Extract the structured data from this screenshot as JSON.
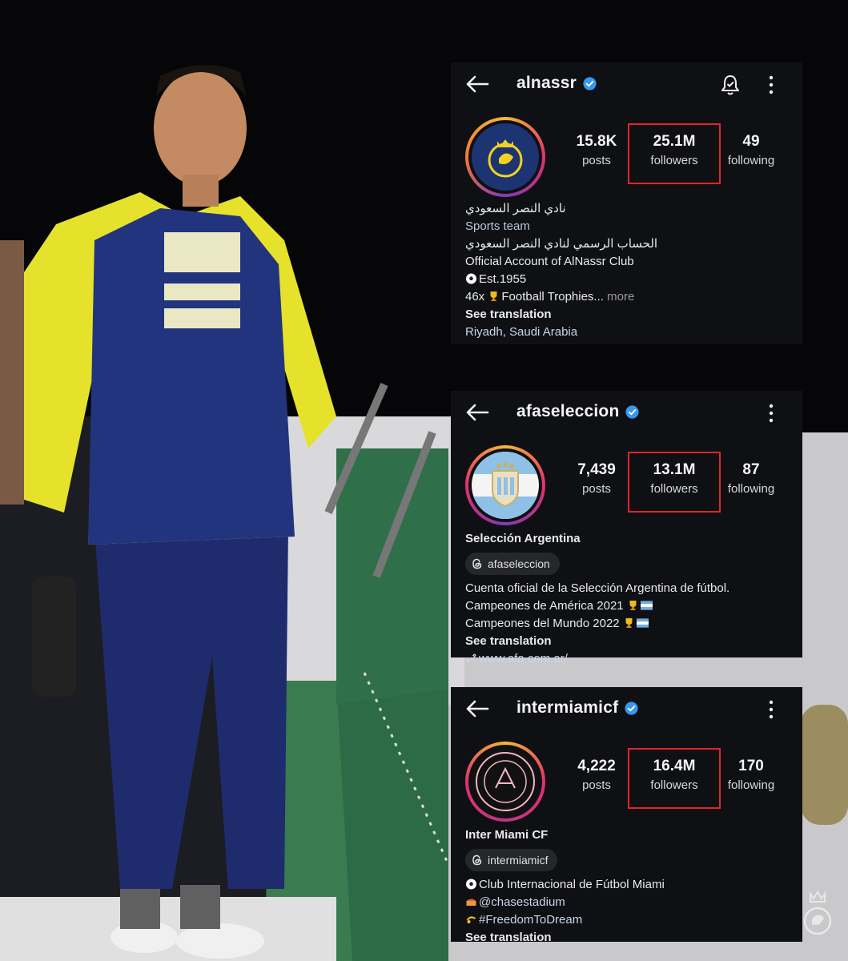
{
  "profiles": [
    {
      "handle": "alnassr",
      "stats": {
        "posts": "15.8K",
        "followers": "25.1M",
        "following": "49"
      },
      "stat_labels": {
        "posts": "posts",
        "followers": "followers",
        "following": "following"
      },
      "bio": {
        "name_ar": "نادي النصر السعودي",
        "category": "Sports team",
        "line_ar": "الحساب الرسمي لنادي النصر السعودي",
        "line1": "Official Account of AlNassr Club",
        "line2": "Est.1955",
        "line3": "46x",
        "line3b": "Football Trophies...",
        "more": "more",
        "see_translation": "See translation",
        "location": "Riyadh, Saudi Arabia"
      }
    },
    {
      "handle": "afaseleccion",
      "stats": {
        "posts": "7,439",
        "followers": "13.1M",
        "following": "87"
      },
      "stat_labels": {
        "posts": "posts",
        "followers": "followers",
        "following": "following"
      },
      "bio": {
        "name": "Selección Argentina",
        "threads": "afaseleccion",
        "line1": "Cuenta oficial de la Selección Argentina de fútbol.",
        "line2": "Campeones de América 2021",
        "line3": "Campeones del Mundo 2022",
        "see_translation": "See translation",
        "website": "www.afa.com.ar/"
      }
    },
    {
      "handle": "intermiamicf",
      "stats": {
        "posts": "4,222",
        "followers": "16.4M",
        "following": "170"
      },
      "stat_labels": {
        "posts": "posts",
        "followers": "followers",
        "following": "following"
      },
      "bio": {
        "name": "Inter Miami CF",
        "threads": "intermiamicf",
        "line1": "Club Internacional de Fútbol Miami",
        "line2": "@chasestadium",
        "line3": "#FreedomToDream",
        "see_translation": "See translation"
      }
    }
  ],
  "colors": {
    "highlight": "#e0262b",
    "verified": "#3897f0",
    "card_bg": "#0f1014"
  },
  "icons": [
    "back-arrow-icon",
    "verified-badge-icon",
    "notification-bell-icon",
    "more-options-icon",
    "threads-icon",
    "link-icon"
  ]
}
